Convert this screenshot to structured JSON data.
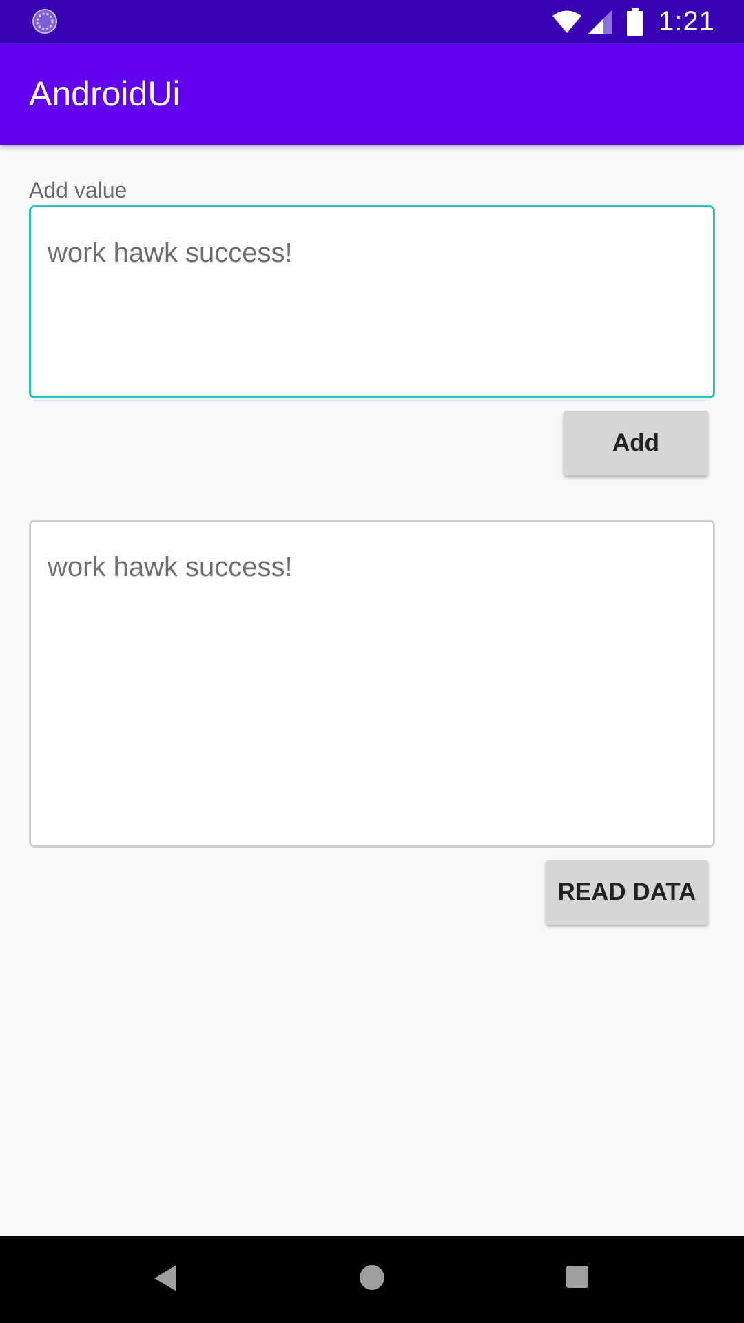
{
  "status_bar": {
    "time": "1:21",
    "icons": [
      "loading-icon",
      "wifi-icon",
      "signal-icon",
      "battery-icon"
    ]
  },
  "app_bar": {
    "title": "AndroidUi"
  },
  "form": {
    "input_label": "Add value",
    "input_value": "work hawk success!",
    "add_button": "Add",
    "output_value": "work hawk success!",
    "read_button": "READ DATA"
  },
  "nav_bar": {
    "icons": [
      "back-icon",
      "home-icon",
      "recents-icon"
    ]
  },
  "colors": {
    "status_bar": "#3700b3",
    "app_bar": "#6200ee",
    "input_focus_border": "#26c6c0",
    "button": "#d6d6d6"
  }
}
